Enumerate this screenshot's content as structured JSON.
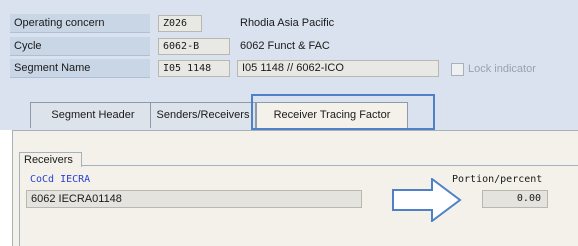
{
  "header": {
    "operating_concern": {
      "label": "Operating concern",
      "value": "Z026",
      "description": "Rhodia Asia Pacific"
    },
    "cycle": {
      "label": "Cycle",
      "value": "6062-B",
      "description": "6062 Funct & FAC"
    },
    "segment_name": {
      "label": "Segment Name",
      "value": "I05 1148",
      "description": "I05 1148 // 6062-ICO"
    },
    "lock_indicator": {
      "label": "Lock indicator",
      "checked": false
    }
  },
  "tabs": [
    {
      "label": "Segment Header",
      "active": false
    },
    {
      "label": "Senders/Receivers",
      "active": false
    },
    {
      "label": "Receiver Tracing Factor",
      "active": true
    }
  ],
  "receivers": {
    "group_title": "Receivers",
    "col_cocd": "CoCd IECRA",
    "col_portion": "Portion/percent",
    "receiver_value": "6062 IECRA01148",
    "portion_value": "0.00"
  },
  "colors": {
    "highlight": "#4f81c8",
    "link_blue": "#2a3fd0"
  }
}
